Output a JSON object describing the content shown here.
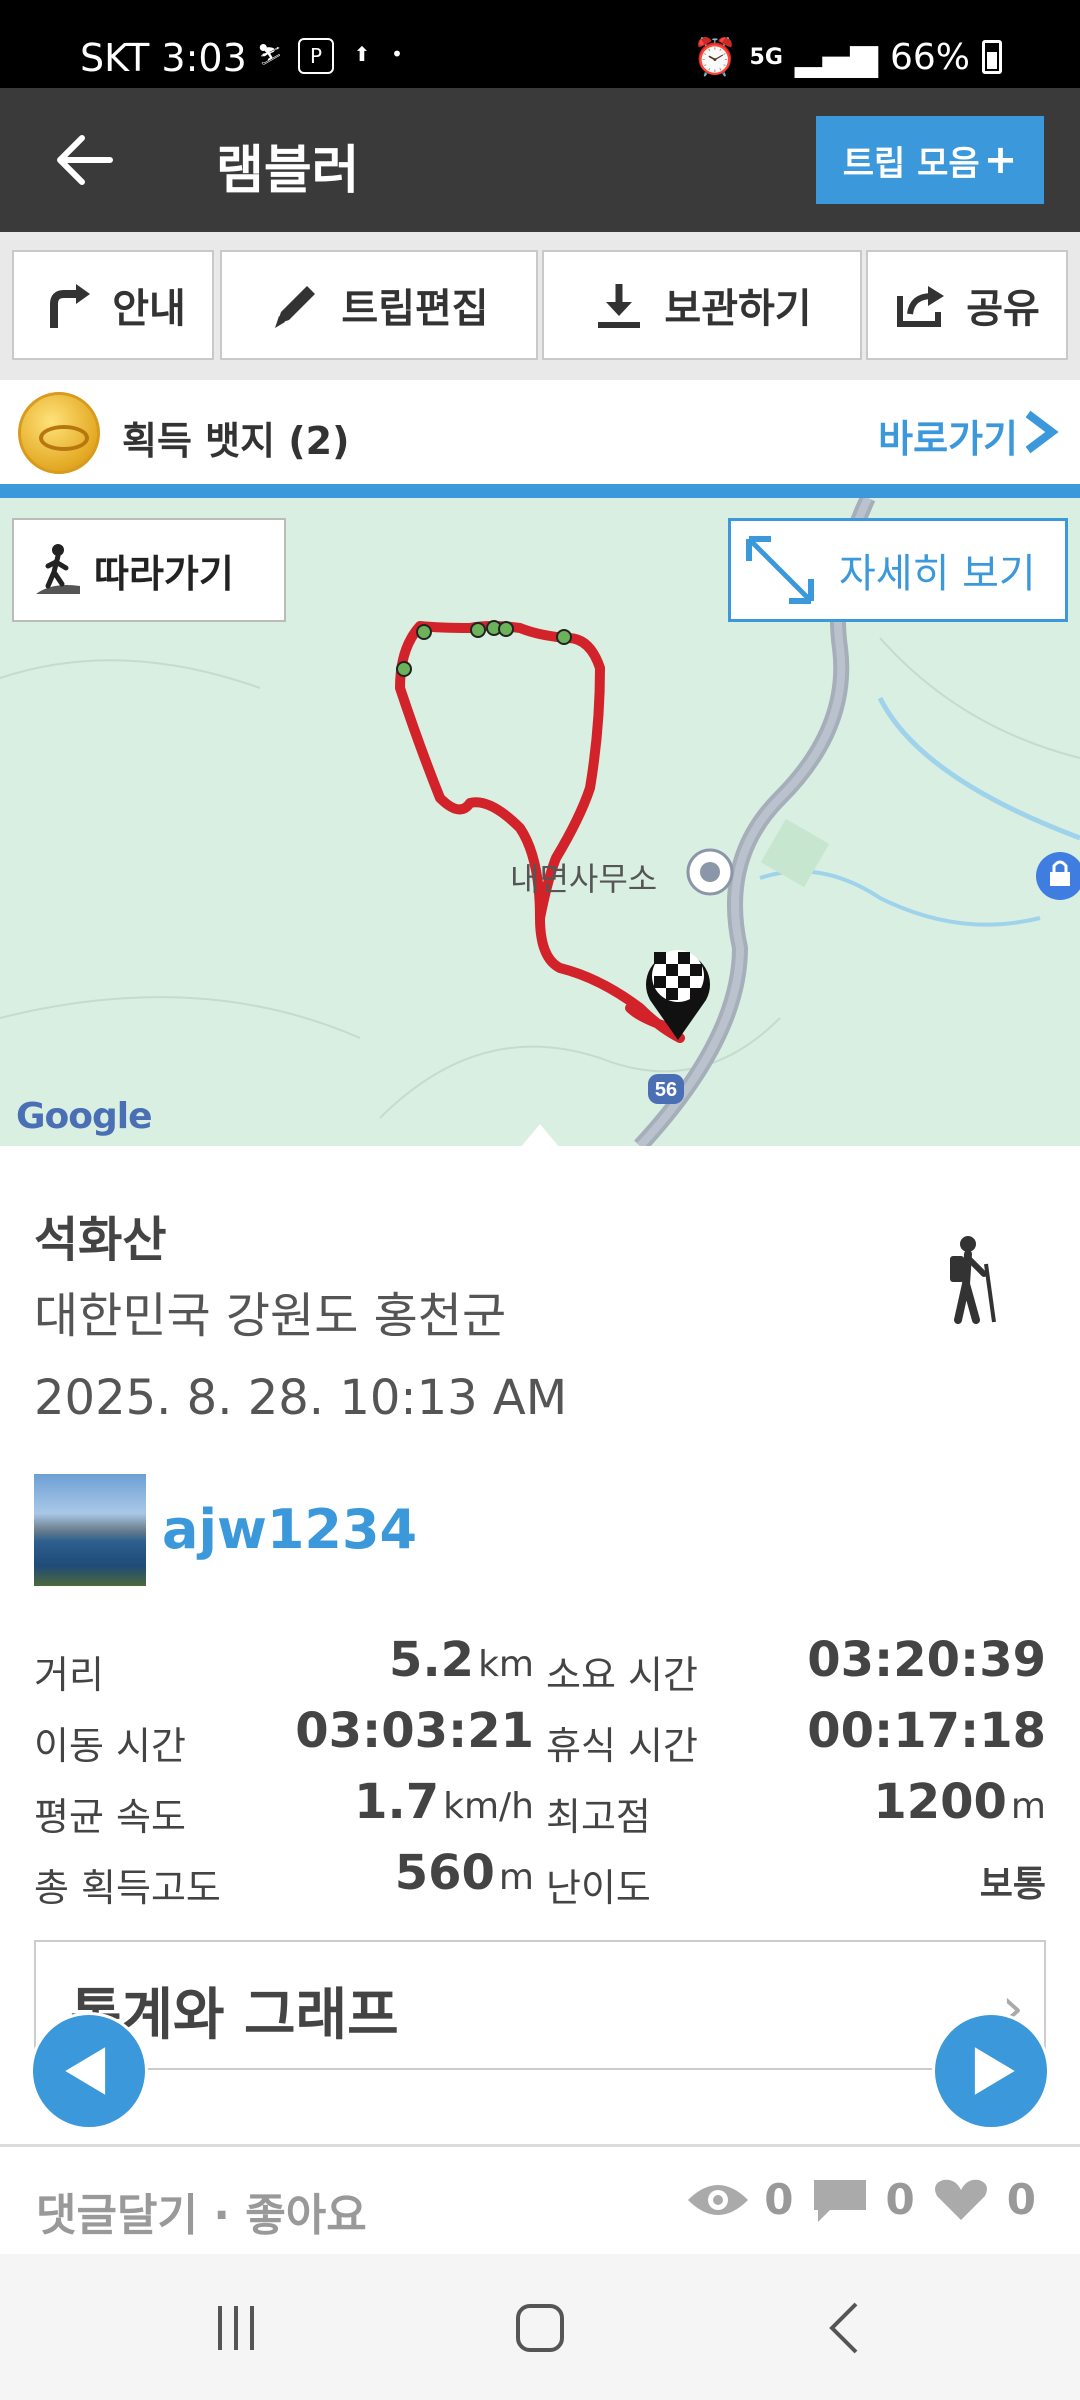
{
  "status_bar": {
    "carrier": "SKT",
    "time": "3:03",
    "network": "5G",
    "battery": "66%"
  },
  "header": {
    "title": "램블러",
    "trip_button": "트립 모음",
    "trip_button_plus": "+"
  },
  "actions": [
    {
      "label": "안내",
      "icon": "turn-right-icon"
    },
    {
      "label": "트립편집",
      "icon": "pencil-icon"
    },
    {
      "label": "보관하기",
      "icon": "download-icon"
    },
    {
      "label": "공유",
      "icon": "share-icon"
    }
  ],
  "badges": {
    "label": "획득 뱃지 (2)",
    "link": "바로가기"
  },
  "map": {
    "follow_button": "따라가기",
    "detail_button": "자세히 보기",
    "place_label": "내면사무소",
    "road_number": "56",
    "attribution": "Google"
  },
  "trip": {
    "name": "석화산",
    "region": "대한민국 강원도 홍천군",
    "datetime": "2025. 8. 28. 10:13 AM",
    "username": "ajw1234"
  },
  "stats": {
    "distance_label": "거리",
    "distance_value": "5.2",
    "distance_unit": "km",
    "duration_label": "소요 시간",
    "duration_value": "03:20:39",
    "moving_label": "이동 시간",
    "moving_value": "03:03:21",
    "rest_label": "휴식 시간",
    "rest_value": "00:17:18",
    "speed_label": "평균 속도",
    "speed_value": "1.7",
    "speed_unit": "km/h",
    "max_alt_label": "최고점",
    "max_alt_value": "1200",
    "max_alt_unit": "m",
    "gain_label": "총 획득고도",
    "gain_value": "560",
    "gain_unit": "m",
    "difficulty_label": "난이도",
    "difficulty_value": "보통"
  },
  "stats_box": {
    "label": "통계와 그래프"
  },
  "bottom": {
    "comment_like": "댓글달기 · 좋아요",
    "views": "0",
    "comments": "0",
    "likes": "0"
  },
  "colors": {
    "accent": "#3b98da",
    "header_bg": "#3a3a3a",
    "route": "#d2232a",
    "map_bg": "#d9efe1"
  }
}
